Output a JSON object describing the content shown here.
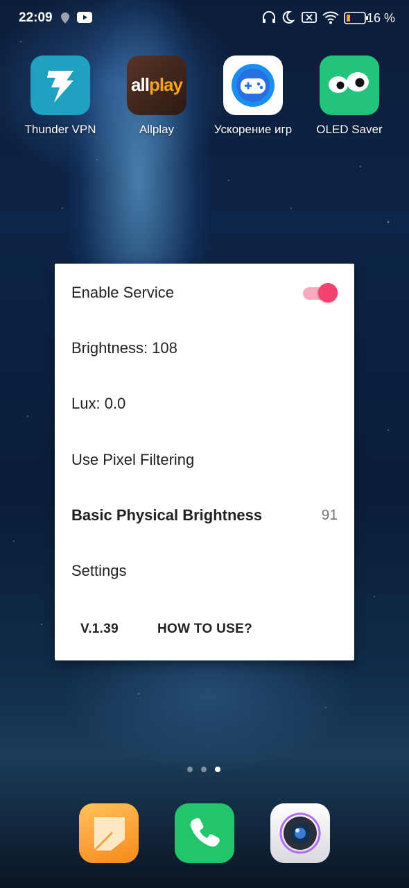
{
  "status_bar": {
    "time": "22:09",
    "battery": "16 %",
    "icons": [
      "location-icon",
      "youtube-icon",
      "headphones-icon",
      "moon-icon",
      "mute-icon",
      "wifi-icon",
      "battery-icon"
    ]
  },
  "apps": [
    {
      "name": "Thunder VPN",
      "icon": "thunder-vpn-icon",
      "color": "#1fa2c2"
    },
    {
      "name": "Allplay",
      "icon": "allplay-icon",
      "icon_text": "allplay",
      "color": "#3a241d"
    },
    {
      "name": "Ускорение игр",
      "icon": "game-boost-icon",
      "color": "#1e88e5"
    },
    {
      "name": "OLED Saver",
      "icon": "oled-saver-icon",
      "color": "#22c37a"
    }
  ],
  "dialog": {
    "enable_service": {
      "label": "Enable Service",
      "enabled": true
    },
    "brightness": "Brightness: 108",
    "lux": "Lux: 0.0",
    "pixel_filtering": "Use Pixel Filtering",
    "basic_physical": {
      "label": "Basic Physical Brightness",
      "value": "91"
    },
    "settings": "Settings",
    "version": "V.1.39",
    "how_to_use": "HOW TO USE?",
    "accent_color": "#f2416f"
  },
  "page_indicator": {
    "pages": 3,
    "current": 3
  },
  "dock": [
    {
      "icon": "notes-icon"
    },
    {
      "icon": "phone-icon"
    },
    {
      "icon": "camera-icon"
    }
  ]
}
